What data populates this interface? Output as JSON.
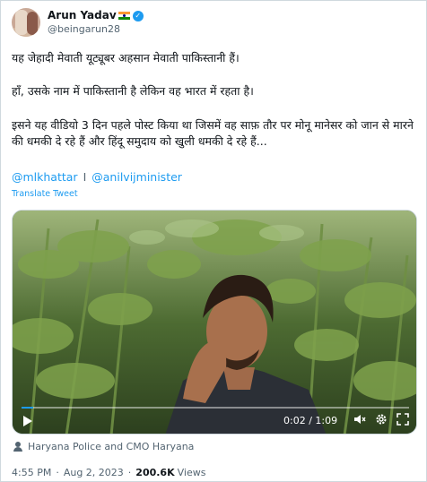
{
  "author": {
    "name": "Arun Yadav",
    "handle": "@beingarun28"
  },
  "tweet": {
    "line1": "यह  जेहादी मेवाती यूट्यूबर अहसान मेवाती पाकिस्तानी हैं।",
    "line2": "हाँ, उसके नाम में पाकिस्तानी है लेकिन वह भारत में रहता है।",
    "line3": "इसने यह वीडियो 3 दिन पहले पोस्ट किया था जिसमें वह साफ़ तौर पर मोनू मानेसर को जान से मारने की धमकी दे रहे हैं और हिंदू समुदाय को खुली धमकी दे रहे हैं...",
    "mention1": "@mlkhattar",
    "mention_separator": "I",
    "mention2": "@anilvijminister",
    "translate": "Translate Tweet"
  },
  "video": {
    "time_display": "0:02 / 1:09",
    "progress_fraction": 0.029,
    "icons": [
      "play-icon",
      "mute-icon",
      "settings-icon",
      "fullscreen-icon"
    ]
  },
  "tagged": {
    "label": "Haryana Police and CMO Haryana"
  },
  "meta": {
    "time": "4:55 PM",
    "separator": "·",
    "date": "Aug 2, 2023",
    "views_count": "200.6K",
    "views_label": "Views"
  },
  "colors": {
    "accent": "#1d9bf0",
    "text": "#0f1419",
    "secondary": "#536471"
  }
}
